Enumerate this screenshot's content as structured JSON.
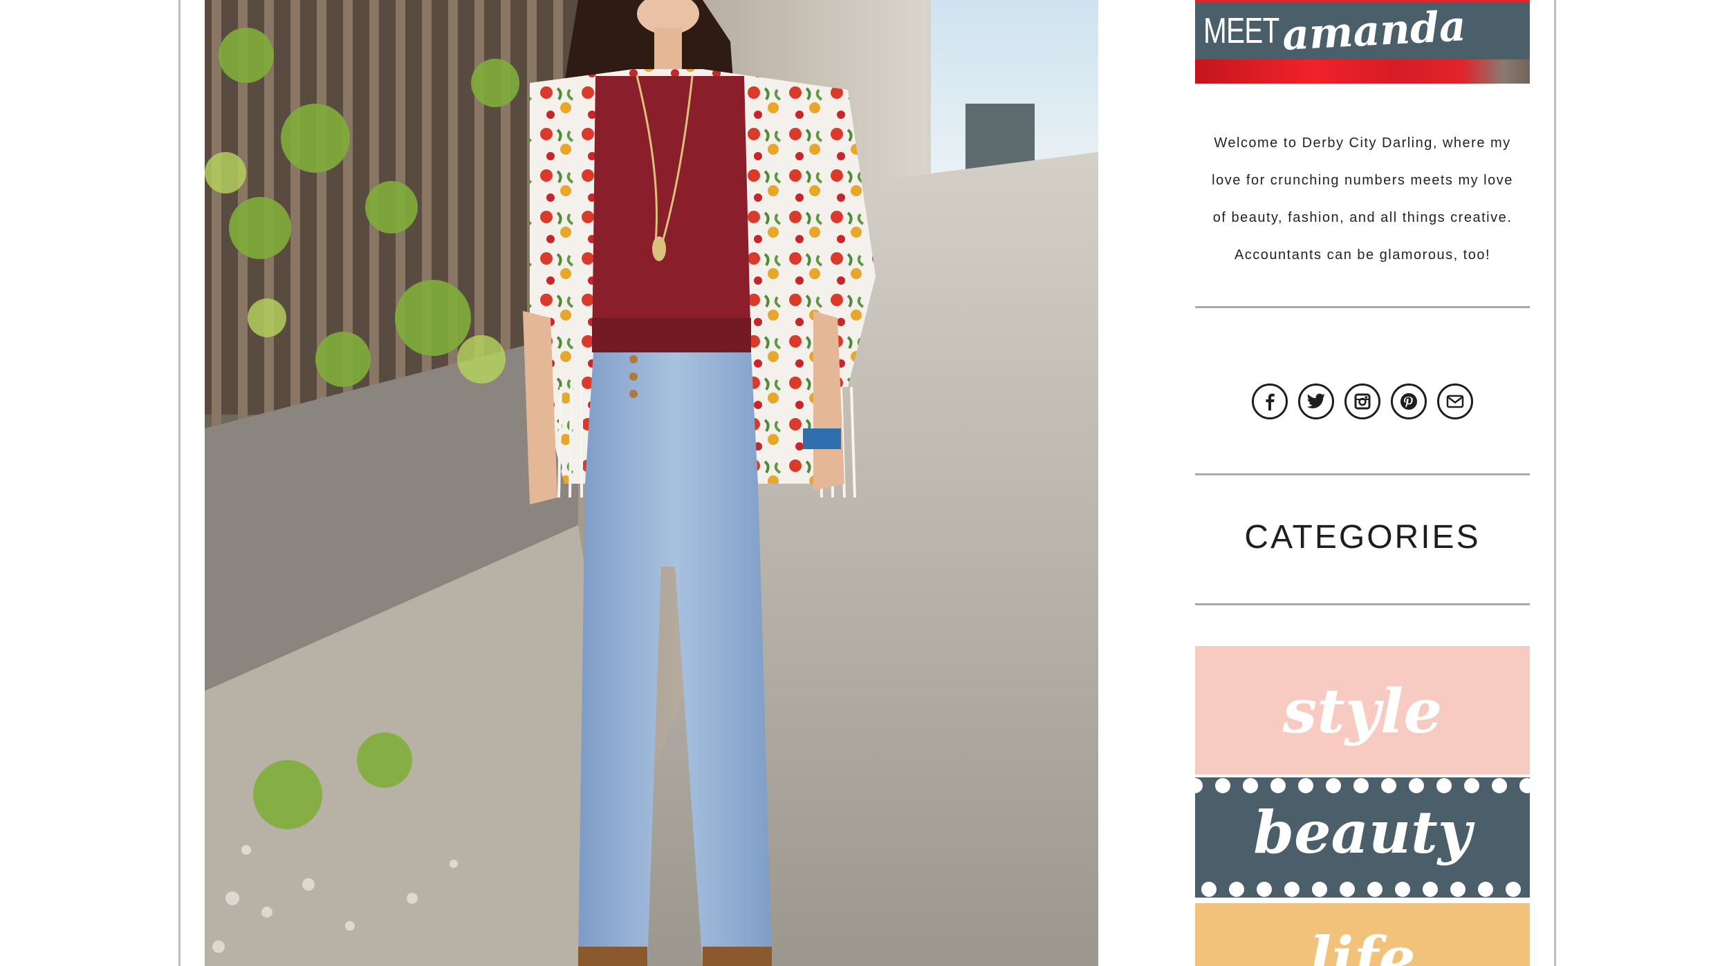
{
  "post": {
    "photo_icon": "outfit-photo"
  },
  "sidebar": {
    "meet": {
      "prefix": "MEET",
      "name": "amanda"
    },
    "welcome_lines": [
      "Welcome to Derby City Darling, where my",
      "love for crunching numbers meets my love",
      "of beauty, fashion, and all things creative.",
      "Accountants can be glamorous, too!"
    ],
    "social": [
      {
        "name": "facebook",
        "icon": "facebook-icon"
      },
      {
        "name": "twitter",
        "icon": "twitter-icon"
      },
      {
        "name": "instagram",
        "icon": "instagram-icon"
      },
      {
        "name": "pinterest",
        "icon": "pinterest-icon"
      },
      {
        "name": "email",
        "icon": "mail-icon"
      }
    ],
    "categories_heading": "CATEGORIES",
    "categories": [
      {
        "label": "style",
        "color": "#f7cbc1"
      },
      {
        "label": "beauty",
        "color": "#4b5f6b"
      },
      {
        "label": "life",
        "color": "#f2c27a"
      }
    ]
  },
  "colors": {
    "slate": "#4b5f6b",
    "red": "#e8232d",
    "divider": "#a9a9a9",
    "frame": "#bdbdbd"
  }
}
